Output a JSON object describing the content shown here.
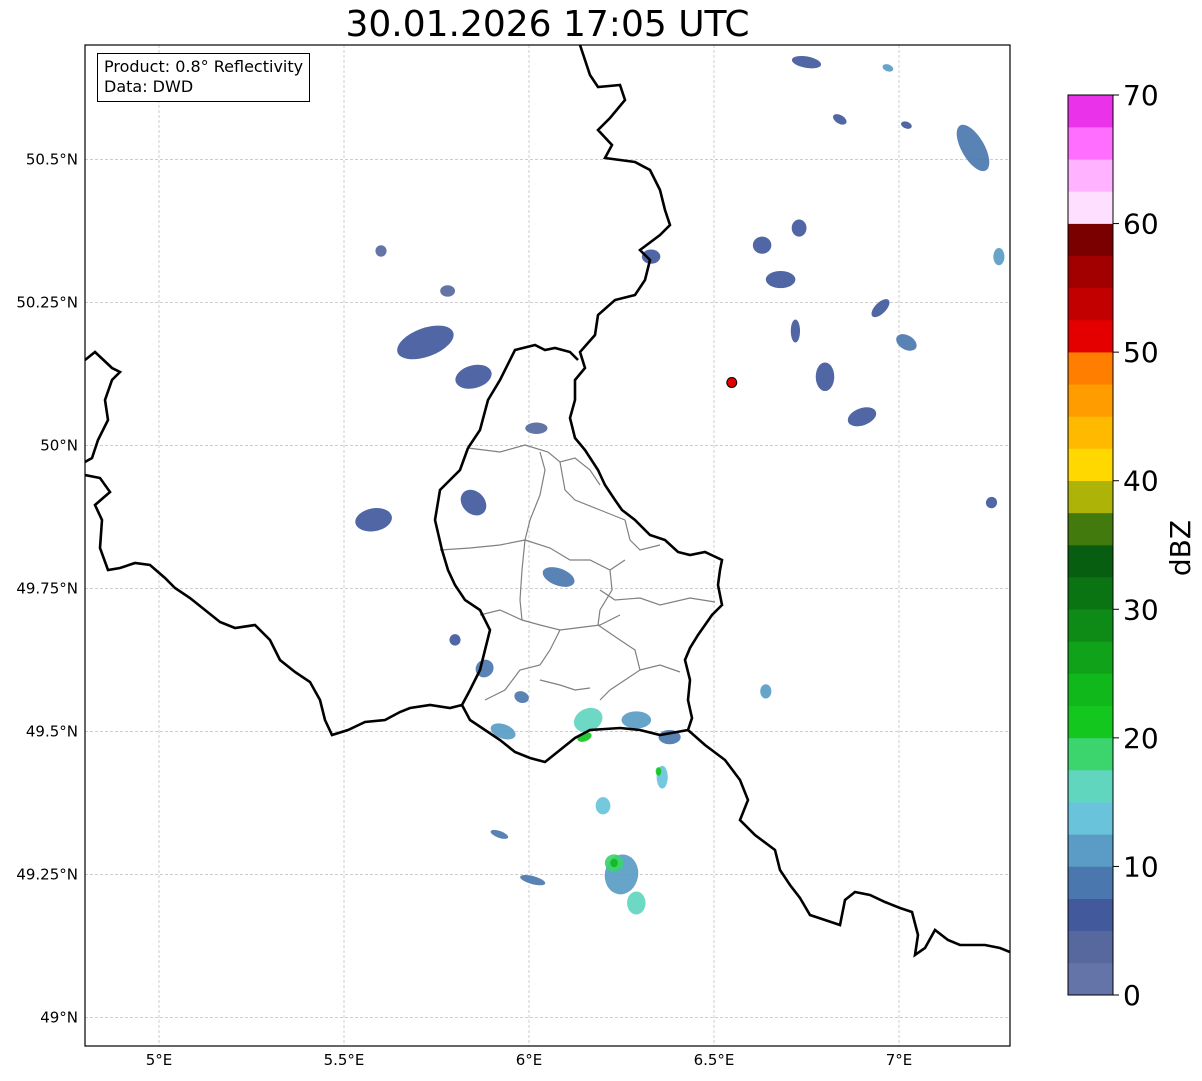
{
  "title": "30.01.2026 17:05 UTC",
  "info": {
    "product": "Product: 0.8° Reflectivity",
    "source": "Data: DWD"
  },
  "map": {
    "lon_range": [
      4.8,
      7.3
    ],
    "lat_range": [
      48.95,
      50.7
    ],
    "grid": true,
    "lon_ticks": [
      {
        "value": 5.0,
        "label": "5°E"
      },
      {
        "value": 5.5,
        "label": "5.5°E"
      },
      {
        "value": 6.0,
        "label": "6°E"
      },
      {
        "value": 6.5,
        "label": "6.5°E"
      },
      {
        "value": 7.0,
        "label": "7°E"
      }
    ],
    "lat_ticks": [
      {
        "value": 49.0,
        "label": "49°N"
      },
      {
        "value": 49.25,
        "label": "49.25°N"
      },
      {
        "value": 49.5,
        "label": "49.5°N"
      },
      {
        "value": 49.75,
        "label": "49.75°N"
      },
      {
        "value": 50.0,
        "label": "50°N"
      },
      {
        "value": 50.25,
        "label": "50.25°N"
      },
      {
        "value": 50.5,
        "label": "50.5°N"
      }
    ],
    "radar_site": {
      "lon": 6.548,
      "lat": 50.11,
      "color": "#e00000"
    },
    "echoes": [
      {
        "lon": 5.72,
        "lat": 50.18,
        "dlon": 0.16,
        "dlat": 0.05,
        "rot": -20,
        "dbz": 6
      },
      {
        "lon": 5.85,
        "lat": 50.12,
        "dlon": 0.1,
        "dlat": 0.04,
        "rot": -15,
        "dbz": 5
      },
      {
        "lon": 5.6,
        "lat": 50.34,
        "dlon": 0.03,
        "dlat": 0.02,
        "rot": 0,
        "dbz": 4
      },
      {
        "lon": 5.78,
        "lat": 50.27,
        "dlon": 0.04,
        "dlat": 0.02,
        "rot": 0,
        "dbz": 4
      },
      {
        "lon": 6.02,
        "lat": 50.03,
        "dlon": 0.06,
        "dlat": 0.02,
        "rot": 0,
        "dbz": 4
      },
      {
        "lon": 5.58,
        "lat": 49.87,
        "dlon": 0.1,
        "dlat": 0.04,
        "rot": -10,
        "dbz": 6
      },
      {
        "lon": 5.85,
        "lat": 49.9,
        "dlon": 0.06,
        "dlat": 0.05,
        "rot": -45,
        "dbz": 6
      },
      {
        "lon": 6.08,
        "lat": 49.77,
        "dlon": 0.09,
        "dlat": 0.03,
        "rot": 20,
        "dbz": 8
      },
      {
        "lon": 5.8,
        "lat": 49.66,
        "dlon": 0.03,
        "dlat": 0.02,
        "rot": 0,
        "dbz": 7
      },
      {
        "lon": 5.88,
        "lat": 49.61,
        "dlon": 0.05,
        "dlat": 0.03,
        "rot": -40,
        "dbz": 8
      },
      {
        "lon": 5.98,
        "lat": 49.56,
        "dlon": 0.04,
        "dlat": 0.02,
        "rot": 20,
        "dbz": 8
      },
      {
        "lon": 5.93,
        "lat": 49.5,
        "dlon": 0.07,
        "dlat": 0.025,
        "rot": 20,
        "dbz": 10
      },
      {
        "lon": 6.16,
        "lat": 49.52,
        "dlon": 0.08,
        "dlat": 0.04,
        "rot": -25,
        "dbz": 16
      },
      {
        "lon": 6.15,
        "lat": 49.49,
        "dlon": 0.04,
        "dlat": 0.015,
        "rot": -20,
        "dbz": 22
      },
      {
        "lon": 6.29,
        "lat": 49.52,
        "dlon": 0.08,
        "dlat": 0.03,
        "rot": 0,
        "dbz": 10
      },
      {
        "lon": 6.38,
        "lat": 49.49,
        "dlon": 0.06,
        "dlat": 0.025,
        "rot": 0,
        "dbz": 8
      },
      {
        "lon": 6.36,
        "lat": 49.42,
        "dlon": 0.03,
        "dlat": 0.04,
        "rot": 0,
        "dbz": 14
      },
      {
        "lon": 6.35,
        "lat": 49.43,
        "dlon": 0.015,
        "dlat": 0.015,
        "rot": 0,
        "dbz": 22
      },
      {
        "lon": 6.2,
        "lat": 49.37,
        "dlon": 0.04,
        "dlat": 0.03,
        "rot": 0,
        "dbz": 14
      },
      {
        "lon": 6.25,
        "lat": 49.25,
        "dlon": 0.09,
        "dlat": 0.07,
        "rot": 10,
        "dbz": 12
      },
      {
        "lon": 6.23,
        "lat": 49.27,
        "dlon": 0.05,
        "dlat": 0.03,
        "rot": 0,
        "dbz": 18
      },
      {
        "lon": 6.23,
        "lat": 49.27,
        "dlon": 0.02,
        "dlat": 0.015,
        "rot": 0,
        "dbz": 24
      },
      {
        "lon": 6.29,
        "lat": 49.2,
        "dlon": 0.05,
        "dlat": 0.04,
        "rot": 0,
        "dbz": 16
      },
      {
        "lon": 5.92,
        "lat": 49.32,
        "dlon": 0.05,
        "dlat": 0.012,
        "rot": 20,
        "dbz": 8
      },
      {
        "lon": 6.01,
        "lat": 49.24,
        "dlon": 0.07,
        "dlat": 0.014,
        "rot": 15,
        "dbz": 8
      },
      {
        "lon": 6.64,
        "lat": 49.57,
        "dlon": 0.03,
        "dlat": 0.025,
        "rot": 0,
        "dbz": 10
      },
      {
        "lon": 6.63,
        "lat": 50.35,
        "dlon": 0.05,
        "dlat": 0.03,
        "rot": 0,
        "dbz": 5
      },
      {
        "lon": 6.68,
        "lat": 50.29,
        "dlon": 0.08,
        "dlat": 0.03,
        "rot": 0,
        "dbz": 5
      },
      {
        "lon": 6.8,
        "lat": 50.12,
        "dlon": 0.05,
        "dlat": 0.05,
        "rot": 0,
        "dbz": 5
      },
      {
        "lon": 6.9,
        "lat": 50.05,
        "dlon": 0.08,
        "dlat": 0.03,
        "rot": -20,
        "dbz": 5
      },
      {
        "lon": 6.73,
        "lat": 50.38,
        "dlon": 0.04,
        "dlat": 0.03,
        "rot": 0,
        "dbz": 5
      },
      {
        "lon": 6.72,
        "lat": 50.2,
        "dlon": 0.025,
        "dlat": 0.04,
        "rot": 0,
        "dbz": 5
      },
      {
        "lon": 6.33,
        "lat": 50.33,
        "dlon": 0.05,
        "dlat": 0.025,
        "rot": 0,
        "dbz": 6
      },
      {
        "lon": 6.95,
        "lat": 50.24,
        "dlon": 0.03,
        "dlat": 0.04,
        "rot": 45,
        "dbz": 6
      },
      {
        "lon": 7.02,
        "lat": 50.18,
        "dlon": 0.06,
        "dlat": 0.025,
        "rot": 30,
        "dbz": 8
      },
      {
        "lon": 7.2,
        "lat": 50.52,
        "dlon": 0.14,
        "dlat": 0.04,
        "rot": 60,
        "dbz": 8
      },
      {
        "lon": 6.84,
        "lat": 50.57,
        "dlon": 0.04,
        "dlat": 0.015,
        "rot": 30,
        "dbz": 6
      },
      {
        "lon": 6.75,
        "lat": 50.67,
        "dlon": 0.08,
        "dlat": 0.02,
        "rot": 10,
        "dbz": 5
      },
      {
        "lon": 6.97,
        "lat": 50.66,
        "dlon": 0.03,
        "dlat": 0.012,
        "rot": 20,
        "dbz": 12
      },
      {
        "lon": 7.02,
        "lat": 50.56,
        "dlon": 0.03,
        "dlat": 0.012,
        "rot": 20,
        "dbz": 5
      },
      {
        "lon": 7.27,
        "lat": 50.33,
        "dlon": 0.03,
        "dlat": 0.03,
        "rot": 0,
        "dbz": 12
      },
      {
        "lon": 7.25,
        "lat": 49.9,
        "dlon": 0.03,
        "dlat": 0.02,
        "rot": 30,
        "dbz": 5
      }
    ]
  },
  "colorbar": {
    "label": "dBZ",
    "range": [
      0,
      70
    ],
    "ticks": [
      0,
      10,
      20,
      30,
      40,
      50,
      60,
      70
    ],
    "colors": [
      "#6574a8",
      "#56689e",
      "#42599c",
      "#4b77af",
      "#5a9cc6",
      "#69c4db",
      "#61d6bf",
      "#3bd46d",
      "#13c71f",
      "#10b81c",
      "#10a219",
      "#0d8b16",
      "#0a7413",
      "#075e10",
      "#437a0d",
      "#adb307",
      "#ffd800",
      "#ffba00",
      "#ff9c00",
      "#ff7e00",
      "#e50000",
      "#c30000",
      "#a20000",
      "#7a0000",
      "#ffdfff",
      "#ffb2ff",
      "#ff6eff",
      "#ea32ea"
    ]
  }
}
